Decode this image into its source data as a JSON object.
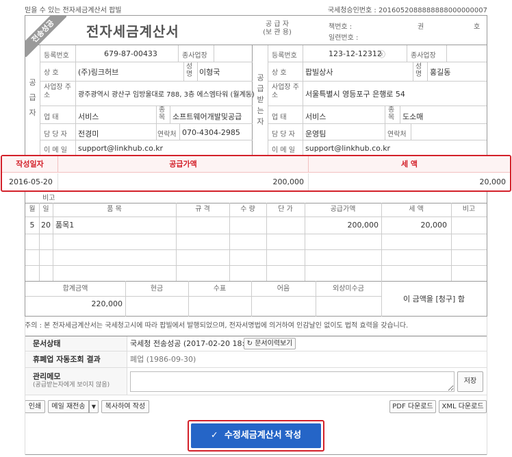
{
  "top": {
    "left_text": "믿을 수 있는 전자세금계산서 팝빌",
    "approval_number": "국세청승인번호 : 2016052088888888000000007"
  },
  "header": {
    "ribbon": "전송성공",
    "title": "전자세금계산서",
    "supplier_role": "공 급 자",
    "supplier_role_sub": "(보 관 용)",
    "book_no_label": "책번호 :",
    "book_unit_1": "권",
    "book_unit_2": "호",
    "serial_label": "일련번호 :"
  },
  "supplier": {
    "side_label": [
      "공",
      "급",
      "자"
    ],
    "reg_label": "등록번호",
    "reg_value": "679-87-00433",
    "branch_label": "종사업장",
    "company_label": "상 호",
    "company_value": "(주)링크허브",
    "name_label": "성명",
    "name_value": "이형국",
    "address_label": "사업장 주소",
    "address_value": "광주광역시 광산구 임방울대로 788, 3층 에스엠타워 (월계동)",
    "biztype_label": "업 태",
    "biztype_value": "서비스",
    "bizitem_label": "종목",
    "bizitem_value": "소프트웨어개발및공급",
    "contact_label": "담 당 자",
    "contact_value": "전경미",
    "phone_label": "연락처",
    "phone_value": "070-4304-2985",
    "email_label": "이 메 일",
    "email_value": "support@linkhub.co.kr"
  },
  "buyer": {
    "side_label": [
      "공",
      "급",
      "받",
      "는",
      "자"
    ],
    "reg_label": "등록번호",
    "reg_value": "123-12-12312",
    "branch_label": "종사업장",
    "company_label": "상 호",
    "company_value": "팝빌상사",
    "name_label": "성명",
    "name_value": "홍길동",
    "address_label": "사업장 주소",
    "address_value": "서울특별시 영등포구 은행로 54",
    "biztype_label": "업 태",
    "biztype_value": "서비스",
    "bizitem_label": "종목",
    "bizitem_value": "도소매",
    "contact_label": "담 당 자",
    "contact_value": "운영팀",
    "phone_label": "연락처",
    "phone_value": "",
    "email_label": "이 메 일",
    "email_value": "support@linkhub.co.kr"
  },
  "amount": {
    "date_label": "작성일자",
    "supply_label": "공급가액",
    "tax_label": "세 액",
    "date_value": "2016-05-20",
    "supply_value": "200,000",
    "tax_value": "20,000"
  },
  "remark_label": "비고",
  "items": {
    "headers": [
      "월",
      "일",
      "품 목",
      "규 격",
      "수 량",
      "단 가",
      "공급가액",
      "세 액",
      "비고"
    ],
    "rows": [
      {
        "month": "5",
        "day": "20",
        "name": "품목1",
        "spec": "",
        "qty": "",
        "price": "",
        "supply": "200,000",
        "tax": "20,000",
        "note": ""
      }
    ]
  },
  "totals": {
    "headers": [
      "합계금액",
      "현금",
      "수표",
      "어음",
      "외상미수금"
    ],
    "total_value": "220,000",
    "claim_text": "이 금액을 [청구] 함"
  },
  "note": "주의 : 본 전자세금계산서는 국세청고시에 따라 팝빌에서 발행되었으며, 전자서명법에 의거하여 인감날인 없이도 법적 효력을 갖습니다.",
  "info": {
    "status_label": "문서상태",
    "status_value": "국세청 전송성공 (2017-02-20 18:18)",
    "history_button": "문서이력보기",
    "closure_label": "휴폐업 자동조회 결과",
    "closure_value": "폐업 (1986-09-30)",
    "memo_label": "관리메모",
    "memo_sub": "(공급받는자에게 보이지 않음)",
    "save_button": "저장"
  },
  "actions": {
    "print": "인쇄",
    "resend_mail": "메일 재전송",
    "copy": "복사하여 작성",
    "pdf": "PDF 다운로드",
    "xml": "XML 다운로드",
    "primary": "수정세금계산서 작성"
  },
  "colors": {
    "accent": "#2565c7",
    "highlight": "#d32029"
  }
}
